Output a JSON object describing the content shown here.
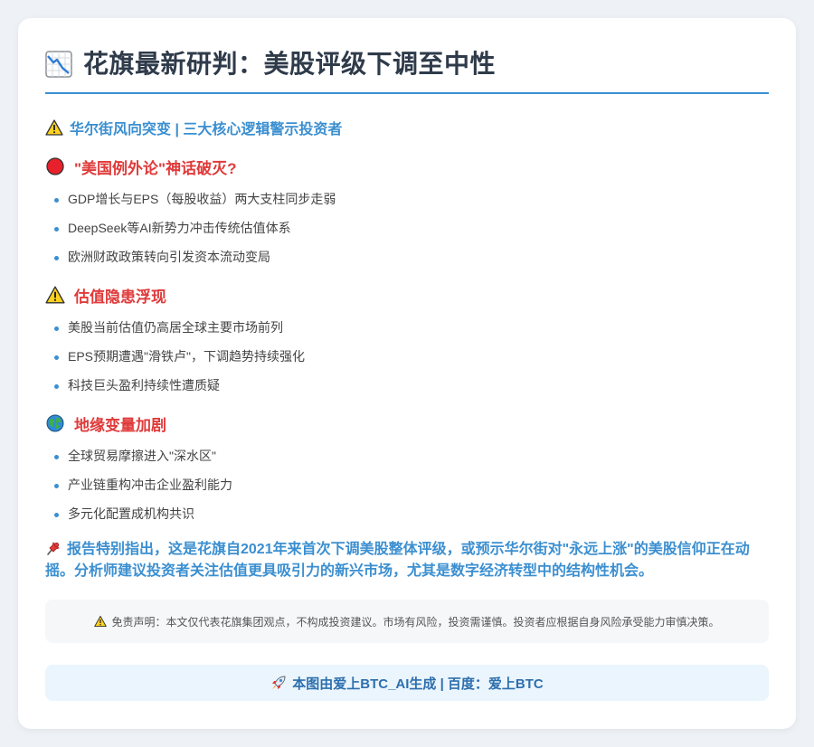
{
  "header": {
    "icon": "chart-decreasing-icon",
    "title": "花旗最新研判：美股评级下调至中性"
  },
  "subtitle": {
    "icon": "warning-icon",
    "text": "华尔街风向突变 | 三大核心逻辑警示投资者"
  },
  "sections": [
    {
      "icon": "red-circle-icon",
      "heading": "\"美国例外论\"神话破灭?",
      "items": [
        "GDP增长与EPS（每股收益）两大支柱同步走弱",
        "DeepSeek等AI新势力冲击传统估值体系",
        "欧洲财政政策转向引发资本流动变局"
      ]
    },
    {
      "icon": "warning-icon",
      "heading": "估值隐患浮现",
      "items": [
        "美股当前估值仍高居全球主要市场前列",
        "EPS预期遭遇\"滑铁卢\"，下调趋势持续强化",
        "科技巨头盈利持续性遭质疑"
      ]
    },
    {
      "icon": "globe-icon",
      "heading": "地缘变量加剧",
      "items": [
        "全球贸易摩擦进入\"深水区\"",
        "产业链重构冲击企业盈利能力",
        "多元化配置成机构共识"
      ]
    }
  ],
  "note": {
    "icon": "pushpin-icon",
    "text": "报告特别指出，这是花旗自2021年来首次下调美股整体评级，或预示华尔街对\"永远上涨\"的美股信仰正在动摇。分析师建议投资者关注估值更具吸引力的新兴市场，尤其是数字经济转型中的结构性机会。"
  },
  "disclaimer": {
    "icon": "warning-icon",
    "text": "免责声明：本文仅代表花旗集团观点，不构成投资建议。市场有风险，投资需谨慎。投资者应根据自身风险承受能力审慎决策。"
  },
  "footer": {
    "icon": "rocket-icon",
    "text": "本图由爱上BTC_AI生成 | 百度：爱上BTC"
  }
}
